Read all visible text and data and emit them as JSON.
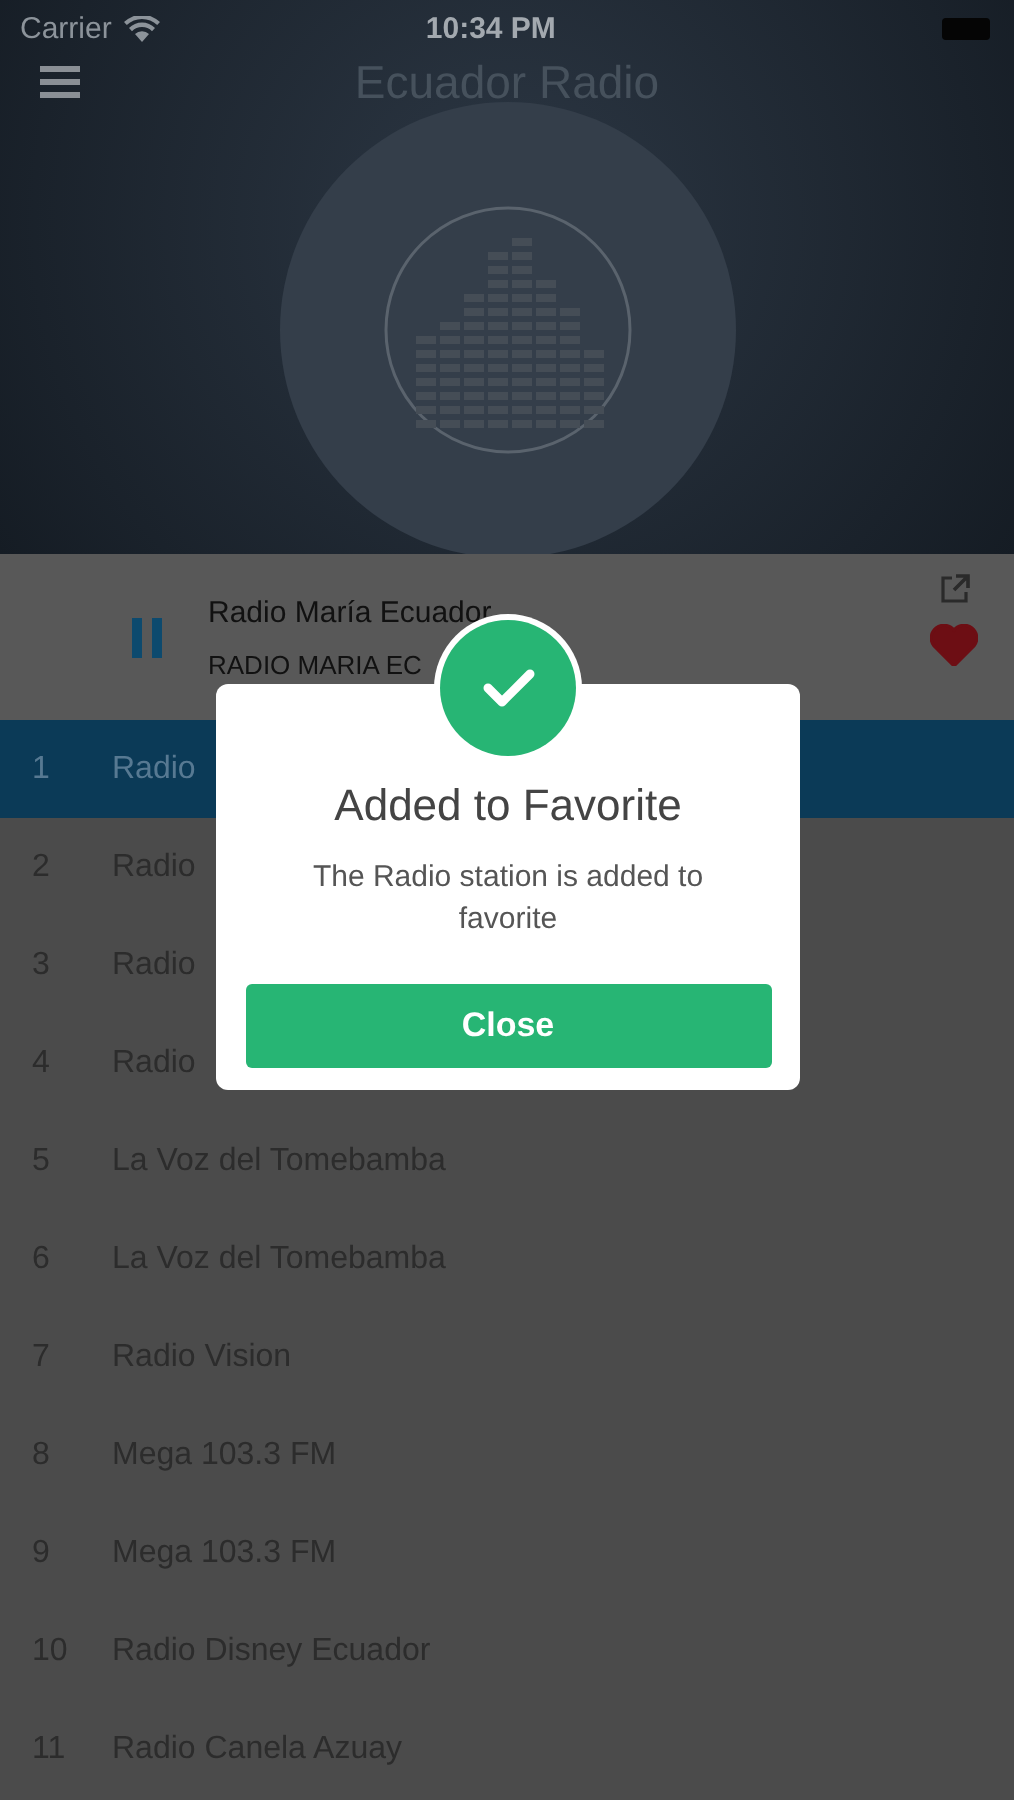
{
  "status_bar": {
    "carrier": "Carrier",
    "time": "10:34 PM"
  },
  "header": {
    "title": "Ecuador Radio"
  },
  "now_playing": {
    "title": "Radio María Ecuador",
    "subtitle": "RADIO MARIA EC",
    "playing": true,
    "favorite": true
  },
  "stations": [
    {
      "number": "1",
      "name": "Radio",
      "selected": true
    },
    {
      "number": "2",
      "name": "Radio",
      "selected": false
    },
    {
      "number": "3",
      "name": "Radio",
      "selected": false
    },
    {
      "number": "4",
      "name": "Radio",
      "selected": false
    },
    {
      "number": "5",
      "name": "La Voz del Tomebamba",
      "selected": false
    },
    {
      "number": "6",
      "name": "La Voz del Tomebamba",
      "selected": false
    },
    {
      "number": "7",
      "name": "Radio Vision",
      "selected": false
    },
    {
      "number": "8",
      "name": "Mega 103.3 FM",
      "selected": false
    },
    {
      "number": "9",
      "name": "Mega 103.3 FM",
      "selected": false
    },
    {
      "number": "10",
      "name": "Radio Disney Ecuador",
      "selected": false
    },
    {
      "number": "11",
      "name": "Radio Canela Azuay",
      "selected": false
    }
  ],
  "dialog": {
    "title": "Added to Favorite",
    "message": "The Radio station is added to favorite",
    "button": "Close"
  }
}
